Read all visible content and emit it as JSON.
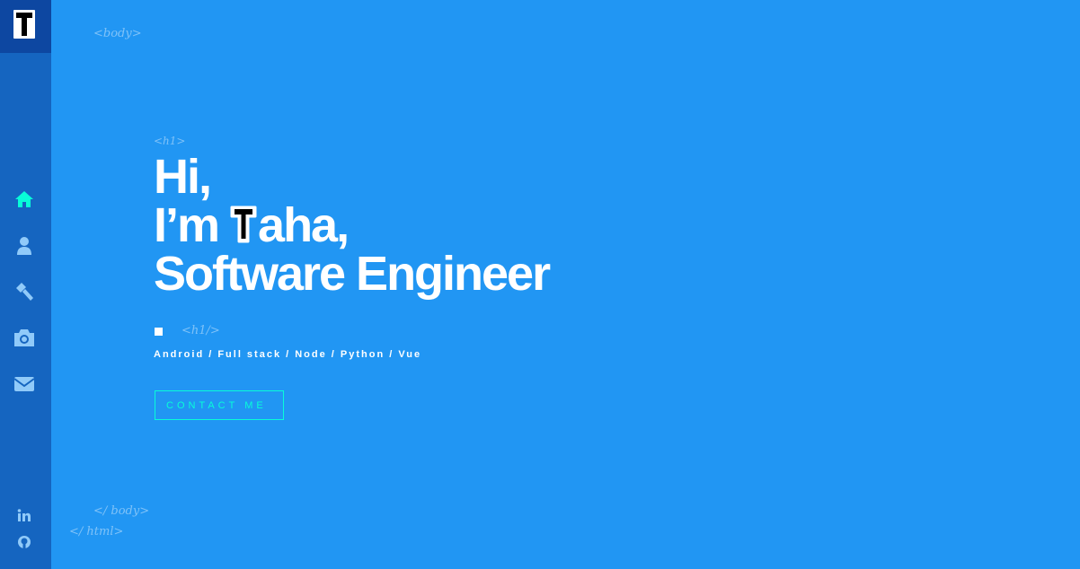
{
  "sidebar": {
    "logo_letter": "T",
    "nav": [
      {
        "icon": "home-icon"
      },
      {
        "icon": "user-icon"
      },
      {
        "icon": "hammer-icon"
      },
      {
        "icon": "camera-icon"
      },
      {
        "icon": "envelope-icon"
      }
    ],
    "social": [
      {
        "icon": "linkedin-icon",
        "label": "in"
      },
      {
        "icon": "github-icon"
      }
    ]
  },
  "tags": {
    "body_open": "<body>",
    "h1_open": "<h1>",
    "h1_close": "<h1/>",
    "body_close": "</ body>",
    "html_close": "</ html>"
  },
  "hero": {
    "line1": "Hi,",
    "line2_prefix": "I’m ",
    "line2_badge": "T",
    "line2_suffix": "aha,",
    "line3": "Software Engineer"
  },
  "subtitle": "Android / Full stack / Node / Python / Vue",
  "contact_button": "CONTACT ME",
  "colors": {
    "background": "#2196f3",
    "sidebar": "#1565c0",
    "logo_bg": "#0d47a1",
    "accent": "#08fdd8",
    "active_nav": "#08fdd8",
    "nav_icon": "#90caf9"
  }
}
